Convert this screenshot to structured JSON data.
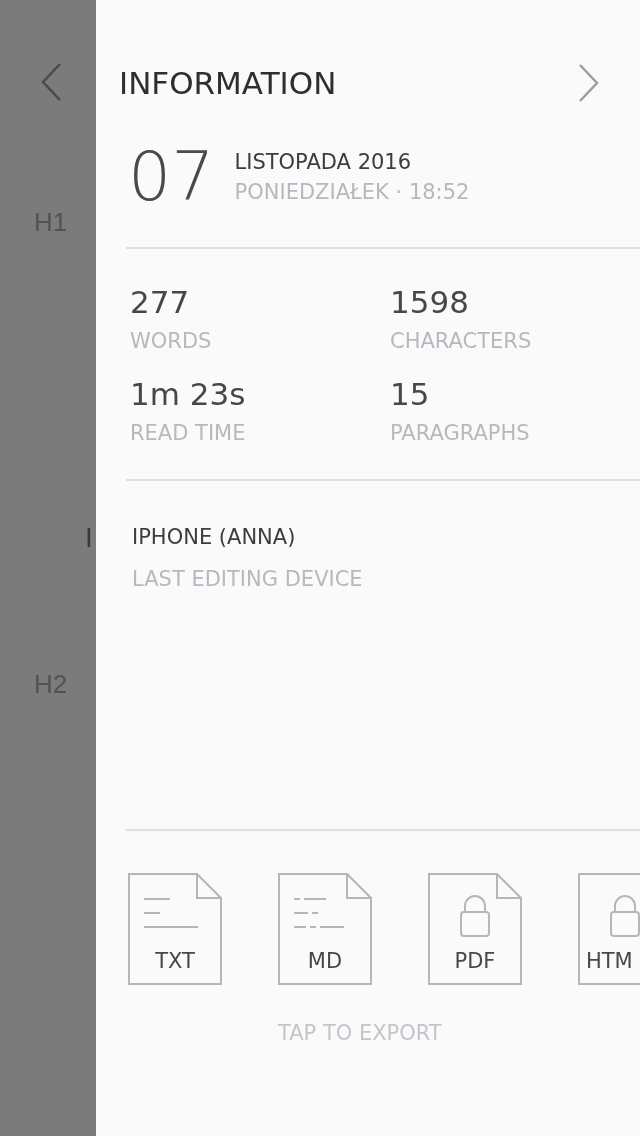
{
  "document": {
    "sections": [
      {
        "marker": "H1",
        "lines": [
          {
            "kind": "blank"
          },
          {
            "kind": "blank"
          },
          {
            "kind": "blank"
          },
          {
            "kind": "blank"
          },
          {
            "kind": "blank"
          },
          {
            "kind": "body",
            "text": "I"
          },
          {
            "kind": "blank"
          },
          {
            "kind": "blank"
          }
        ]
      },
      {
        "marker": "H2",
        "lines": [
          {
            "kind": "blank"
          },
          {
            "kind": "blank"
          },
          {
            "kind": "blank"
          }
        ]
      }
    ]
  },
  "panel": {
    "title": "INFORMATION",
    "date": {
      "day": "07",
      "month_year": "LISTOPADA 2016",
      "weekday_time": "PONIEDZIAŁEK · 18:52"
    },
    "stats": [
      {
        "value": "277",
        "label": "WORDS"
      },
      {
        "value": "1598",
        "label": "CHARACTERS"
      },
      {
        "value": "1m 23s",
        "label": "READ TIME"
      },
      {
        "value": "15",
        "label": "PARAGRAPHS"
      }
    ],
    "device": {
      "name": "IPHONE (ANNA)",
      "label": "LAST EDITING DEVICE"
    },
    "exports": [
      {
        "label": "TXT",
        "kind": "lines"
      },
      {
        "label": "MD",
        "kind": "markdown"
      },
      {
        "label": "PDF",
        "kind": "locked"
      },
      {
        "label": "HTM",
        "kind": "locked"
      }
    ],
    "export_hint": "TAP TO EXPORT"
  }
}
